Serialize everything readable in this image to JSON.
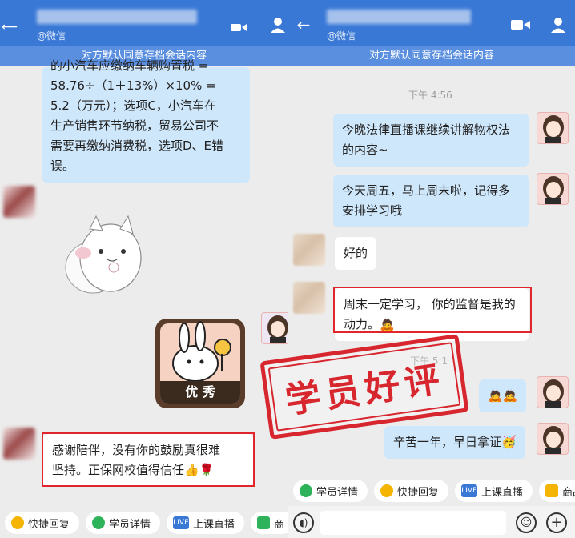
{
  "left": {
    "header": {
      "subtitle": "@微信"
    },
    "notice": "对方默认同意存档会话内容",
    "message_top": {
      "lines": [
        "的小汽车应缴纳车辆购置税 =",
        "58.76÷（1＋13%）×10% =",
        "5.2（万元）；选项C，小汽车在",
        "生产销售环节纳税，贸易公司不",
        "需要再缴纳消费税，选项D、E错",
        "误。"
      ]
    },
    "sticker_text": "优 秀",
    "message_bottom": {
      "lines": [
        "感谢陪伴，没有你的鼓励真很难",
        "坚持。正保网校值得信任👍🌹"
      ]
    },
    "toolbar": [
      "快捷回复",
      "学员详情",
      "上课直播",
      "商"
    ]
  },
  "right": {
    "header": {
      "subtitle": "@微信"
    },
    "notice": "对方默认同意存档会话内容",
    "time1": "下午 4:56",
    "messages": [
      {
        "side": "right",
        "lines": [
          "今晚法律直播课继续讲解物权法",
          "的内容~"
        ]
      },
      {
        "side": "right",
        "lines": [
          "今天周五，马上周末啦，记得多",
          "安排学习哦"
        ]
      },
      {
        "side": "left",
        "lines": [
          "好的"
        ]
      },
      {
        "side": "left",
        "lines": [
          "周末一定学习， 你的监督是我的",
          "动力。🙇"
        ]
      },
      {
        "side": "right",
        "lines": [
          "🙇🙇"
        ]
      },
      {
        "side": "right",
        "lines": [
          "辛苦一年，早日拿证🥳"
        ]
      }
    ],
    "time2": "下午 5:1",
    "toolbar": [
      "学员详情",
      "快捷回复",
      "上课直播",
      "商品"
    ]
  },
  "stamp_text": "学员好评",
  "colors": {
    "header": "#3a78d6",
    "notice": "#5a8fe0",
    "bubble": "#cfe7fb",
    "highlight": "#e0262c"
  }
}
